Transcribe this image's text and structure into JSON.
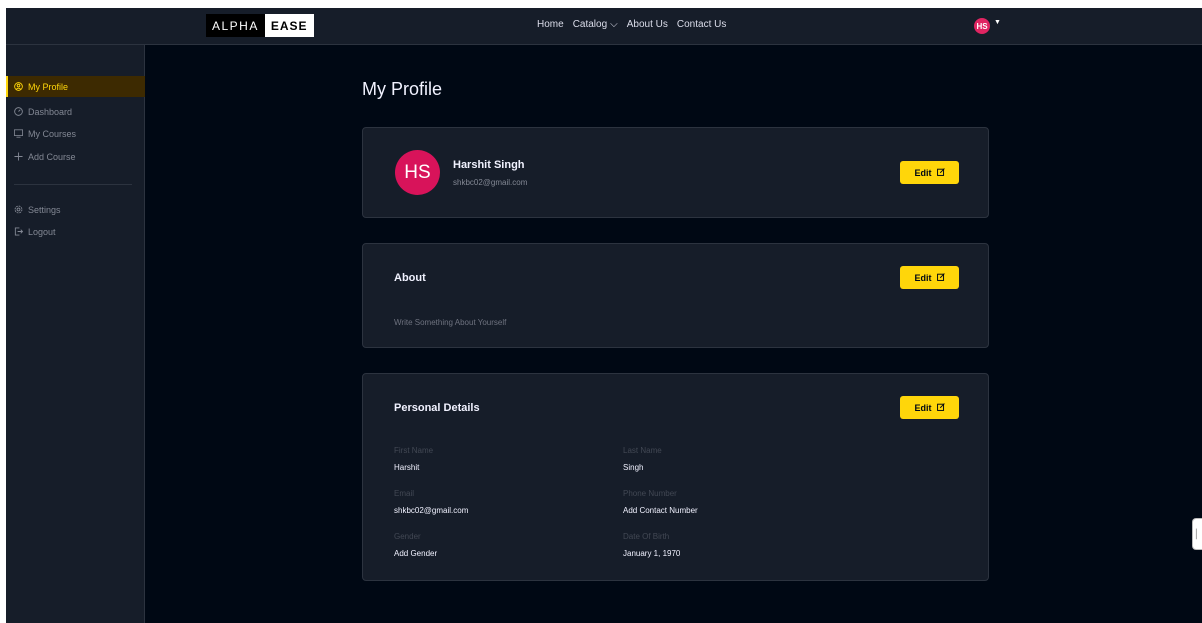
{
  "header": {
    "logo_part1": "ALPHA",
    "logo_part2": "EASE",
    "nav": [
      "Home",
      "Catalog",
      "About Us",
      "Contact Us"
    ],
    "avatar_initials": "HS"
  },
  "sidebar": {
    "items": [
      {
        "label": "My Profile",
        "icon": "user-circle-icon"
      },
      {
        "label": "Dashboard",
        "icon": "dashboard-icon"
      },
      {
        "label": "My Courses",
        "icon": "monitor-icon"
      },
      {
        "label": "Add Course",
        "icon": "plus-icon"
      }
    ],
    "bottom_items": [
      {
        "label": "Settings",
        "icon": "gear-icon"
      },
      {
        "label": "Logout",
        "icon": "logout-icon"
      }
    ]
  },
  "page": {
    "title": "My Profile",
    "edit_label": "Edit"
  },
  "profile": {
    "initials": "HS",
    "name": "Harshit Singh",
    "email": "shkbc02@gmail.com"
  },
  "about": {
    "title": "About",
    "text": "Write Something About Yourself"
  },
  "details": {
    "title": "Personal Details",
    "first_name_label": "First Name",
    "first_name": "Harshit",
    "last_name_label": "Last Name",
    "last_name": "Singh",
    "email_label": "Email",
    "email": "shkbc02@gmail.com",
    "phone_label": "Phone Number",
    "phone": "Add Contact Number",
    "gender_label": "Gender",
    "gender": "Add Gender",
    "dob_label": "Date Of Birth",
    "dob": "January 1, 1970"
  },
  "colors": {
    "accent": "#ffd60a",
    "background": "#000814",
    "panel": "#161d29",
    "avatar": "#d8135a"
  }
}
